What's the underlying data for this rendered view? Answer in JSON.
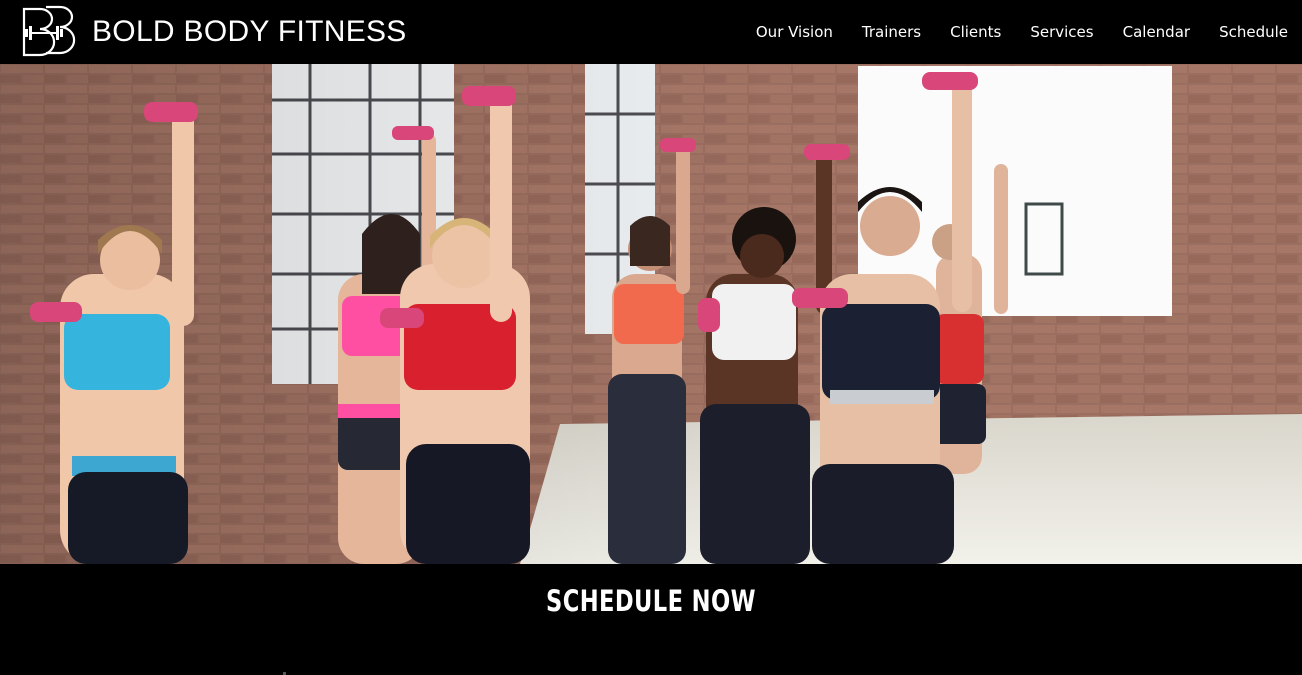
{
  "header": {
    "brand": "BOLD BODY FITNESS",
    "logo_icon": "bb-dumbbell-logo-icon",
    "nav": [
      {
        "label": "Our Vision"
      },
      {
        "label": "Trainers"
      },
      {
        "label": "Clients"
      },
      {
        "label": "Services"
      },
      {
        "label": "Calendar"
      },
      {
        "label": "Schedule"
      }
    ]
  },
  "hero": {
    "image": "group-fitness-class-dumbbells-photo"
  },
  "cta": {
    "title": "SCHEDULE NOW"
  },
  "colors": {
    "background": "#000000",
    "text": "#ffffff",
    "brick": "#8a5a4a",
    "dumbbell": "#d9467a"
  }
}
